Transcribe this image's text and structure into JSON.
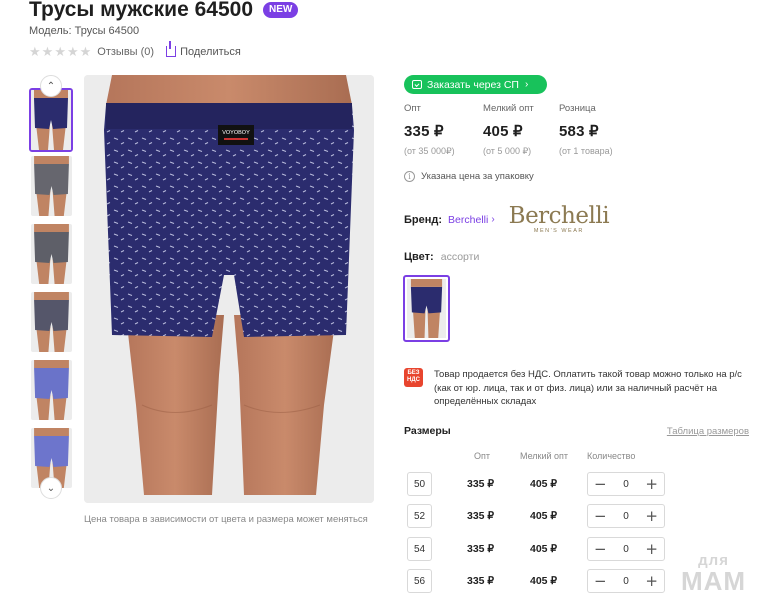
{
  "product": {
    "title": "Трусы мужские 64500",
    "badge": "NEW",
    "model": "Модель: Трусы 64500",
    "reviews": "Отзывы (0)",
    "share": "Поделиться"
  },
  "gallery": {
    "up_arrow": "⌃",
    "down_arrow": "⌄",
    "main_label": "VOYOBOY",
    "thumbs": [
      {
        "color": "#2b2c6e",
        "active": true
      },
      {
        "color": "#66666e",
        "active": false
      },
      {
        "color": "#5e5f68",
        "active": false
      },
      {
        "color": "#55566a",
        "active": false
      },
      {
        "color": "#6a73c9",
        "active": false
      },
      {
        "color": "#6d75cc",
        "active": false
      }
    ],
    "price_note": "Цена товара в зависимости от цвета и размера может меняться"
  },
  "order": {
    "button_label": "Заказать через СП",
    "chevron": "›"
  },
  "prices": [
    {
      "label": "Опт",
      "value": "335 ₽",
      "sub": "(от 35 000₽)"
    },
    {
      "label": "Мелкий опт",
      "value": "405 ₽",
      "sub": "(от 5 000 ₽)"
    },
    {
      "label": "Розница",
      "value": "583 ₽",
      "sub": "(от 1 товара)"
    }
  ],
  "pack_note": "Указана цена за упаковку",
  "brand": {
    "label": "Бренд:",
    "name": "Berchelli",
    "chevron": "›",
    "logo_name": "Berchelli",
    "logo_sub": "MEN'S WEAR"
  },
  "color": {
    "label": "Цвет:",
    "value": "ассорти"
  },
  "vat": {
    "icon_line1": "БЕЗ",
    "icon_line2": "НДС",
    "text": "Товар продается без НДС. Оплатить такой товар можно только на р/с (как от юр. лица, так и от физ. лица) или за наличный расчёт на определённых складах"
  },
  "sizes": {
    "title": "Размеры",
    "table_link": "Таблица размеров",
    "headers": {
      "opt": "Опт",
      "small_opt": "Мелкий опт",
      "qty": "Количество"
    },
    "rows": [
      {
        "size": "50",
        "opt": "335 ₽",
        "small_opt": "405 ₽",
        "qty": "0",
        "minus": "−",
        "plus": "+"
      },
      {
        "size": "52",
        "opt": "335 ₽",
        "small_opt": "405 ₽",
        "qty": "0",
        "minus": "−",
        "plus": "+"
      },
      {
        "size": "54",
        "opt": "335 ₽",
        "small_opt": "405 ₽",
        "qty": "0",
        "minus": "−",
        "plus": "+"
      },
      {
        "size": "56",
        "opt": "335 ₽",
        "small_opt": "405 ₽",
        "qty": "0",
        "minus": "−",
        "plus": "+"
      }
    ]
  },
  "watermark": {
    "line1": "для",
    "line2": "МАМ"
  },
  "colors": {
    "accent": "#7b3fe4",
    "order_green": "#18c25b",
    "vat_red": "#e8452e",
    "product_navy": "#2b2c6e"
  }
}
